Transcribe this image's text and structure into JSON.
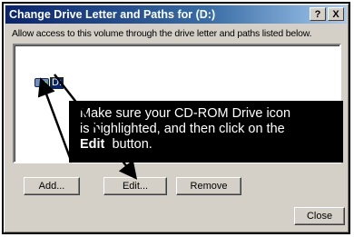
{
  "window": {
    "title": "Change Drive Letter and Paths for  (D:)",
    "help_label": "?",
    "close_label": "X"
  },
  "instructions": "Allow access to this volume through the drive letter and paths listed below.",
  "list": {
    "items": [
      {
        "label": "D:",
        "icon": "cdrom-drive-icon",
        "selected": true
      }
    ]
  },
  "callout": {
    "line1": "Make sure your CD-ROM Drive icon",
    "line2": "is highlighted, and then click on the",
    "bold_word": "Edit",
    "line3_rest": "  button."
  },
  "buttons": {
    "add": "Add...",
    "edit": "Edit...",
    "remove": "Remove",
    "close": "Close"
  },
  "colors": {
    "title_bar": "#0a246a",
    "selection": "#0a246a",
    "dialog_face": "#d4d0c8",
    "callout_bg": "#000000"
  }
}
